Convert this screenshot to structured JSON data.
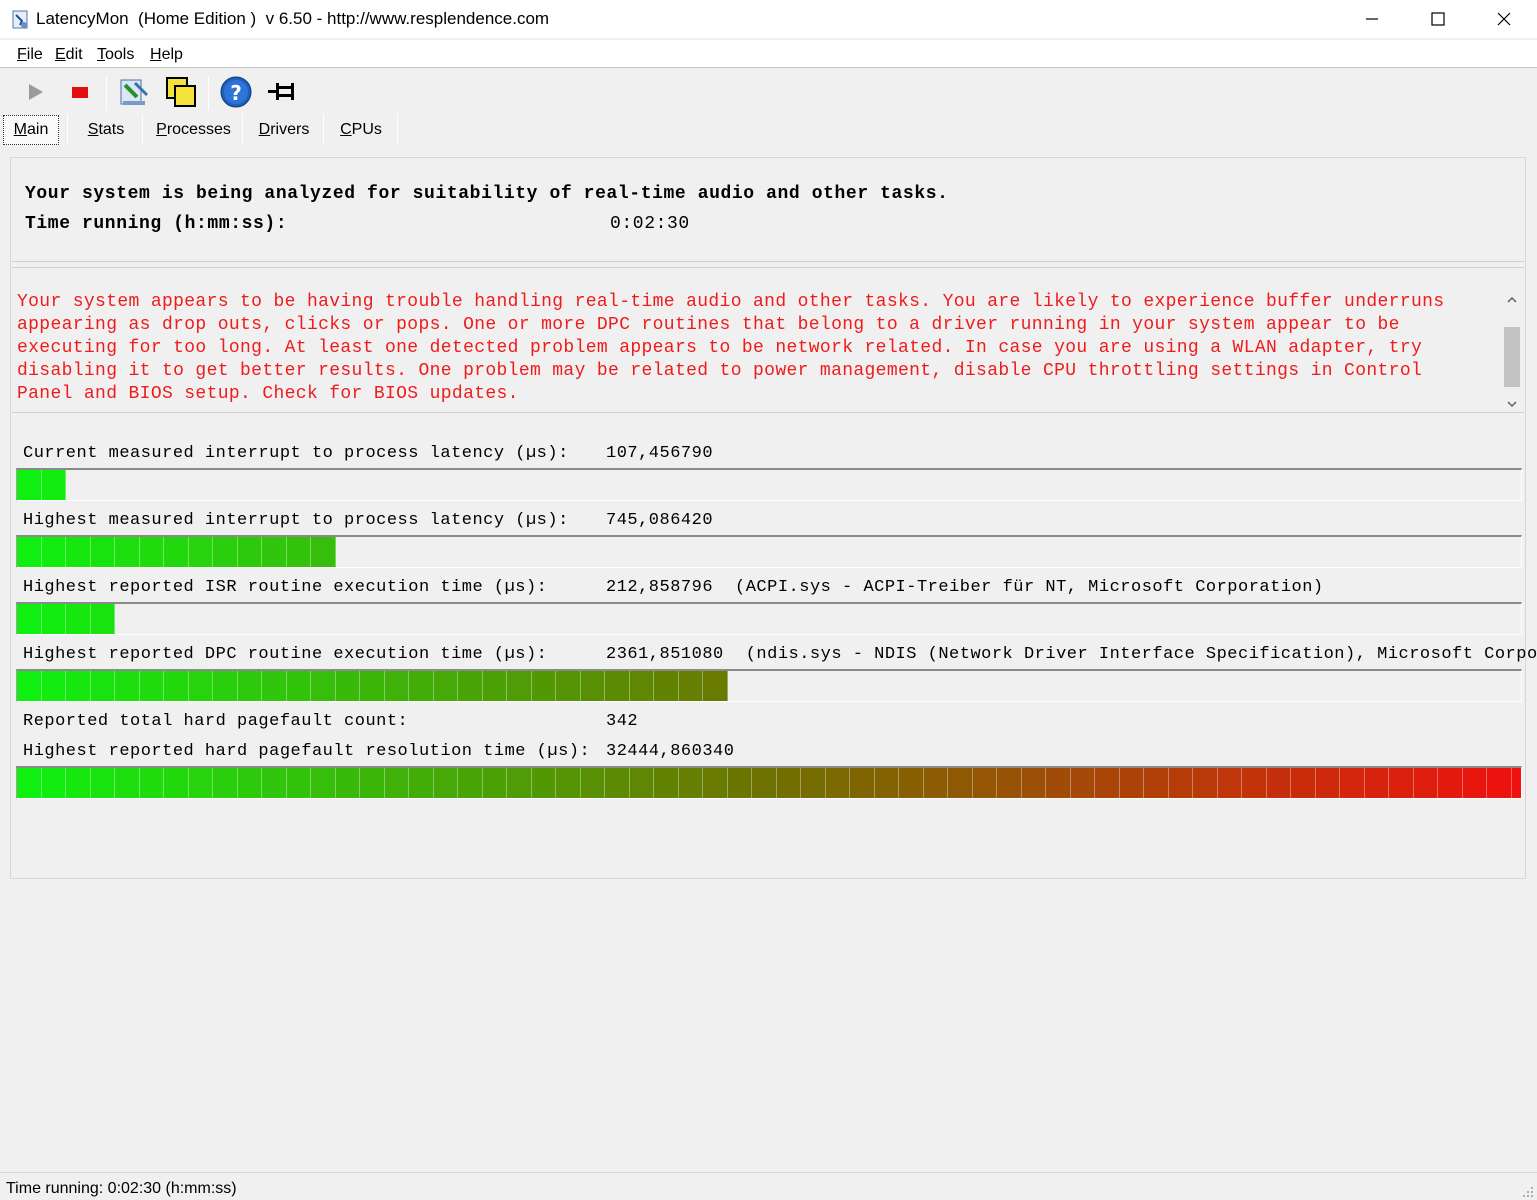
{
  "window": {
    "title": "LatencyMon  (Home Edition )  v 6.50 - http://www.resplendence.com"
  },
  "menu": [
    {
      "accel": "F",
      "rest": "ile"
    },
    {
      "accel": "E",
      "rest": "dit"
    },
    {
      "accel": "T",
      "rest": "ools"
    },
    {
      "accel": "H",
      "rest": "elp"
    }
  ],
  "tabs": [
    {
      "accel": "M",
      "rest": "ain"
    },
    {
      "accel": "S",
      "rest": "tats"
    },
    {
      "accel": "P",
      "rest": "rocesses"
    },
    {
      "accel": "D",
      "rest": "rivers"
    },
    {
      "accel": "C",
      "rest": "PUs"
    }
  ],
  "info": {
    "line1": "Your system is being analyzed for suitability of real-time audio and other tasks.",
    "time_label": "Time running (h:mm:ss):",
    "time_value": "0:02:30"
  },
  "warning": {
    "text": "Your system appears to be having trouble handling real-time audio and other tasks. You are likely to experience buffer underruns\nappearing as drop outs, clicks or pops. One or more DPC routines that belong to a driver running in your system appear to be\nexecuting for too long. At least one detected problem appears to be network related. In case you are using a WLAN adapter, try\ndisabling it to get better results. One problem may be related to power management, disable CPU throttling settings in Control\nPanel and BIOS setup. Check for BIOS updates.",
    "color": "#ee1c1c"
  },
  "metrics": {
    "current_latency": {
      "label": "Current measured interrupt to process latency (µs):",
      "value": "107,456790",
      "bar_segments": 2
    },
    "highest_latency": {
      "label": "Highest measured interrupt to process latency (µs):",
      "value": "745,086420",
      "bar_segments": 13
    },
    "isr": {
      "label": "Highest reported ISR routine execution time (µs):",
      "value": "212,858796",
      "extra": "(ACPI.sys - ACPI-Treiber für NT, Microsoft Corporation)",
      "bar_segments": 4
    },
    "dpc": {
      "label": "Highest reported DPC routine execution time (µs):",
      "value": "2361,851080",
      "extra": "(ndis.sys - NDIS (Network Driver Interface Specification), Microsoft Corporatio",
      "bar_segments": 29
    },
    "pagefault_count": {
      "label": "Reported total hard pagefault count:",
      "value": "342"
    },
    "pagefault_time": {
      "label": "Highest reported hard pagefault resolution time (µs):",
      "value": "32444,860340",
      "bar_segments": 62
    },
    "bar_total_segments": 62,
    "bar_colors": {
      "start": "#10f010",
      "mid": "#707000",
      "end": "#f01010"
    }
  },
  "status": {
    "text": "Time running: 0:02:30  (h:mm:ss)"
  },
  "toolbar": {
    "icons": [
      "play-icon",
      "stop-icon",
      "process-tool-icon",
      "window-tool-icon",
      "help-icon",
      "pin-icon"
    ]
  }
}
